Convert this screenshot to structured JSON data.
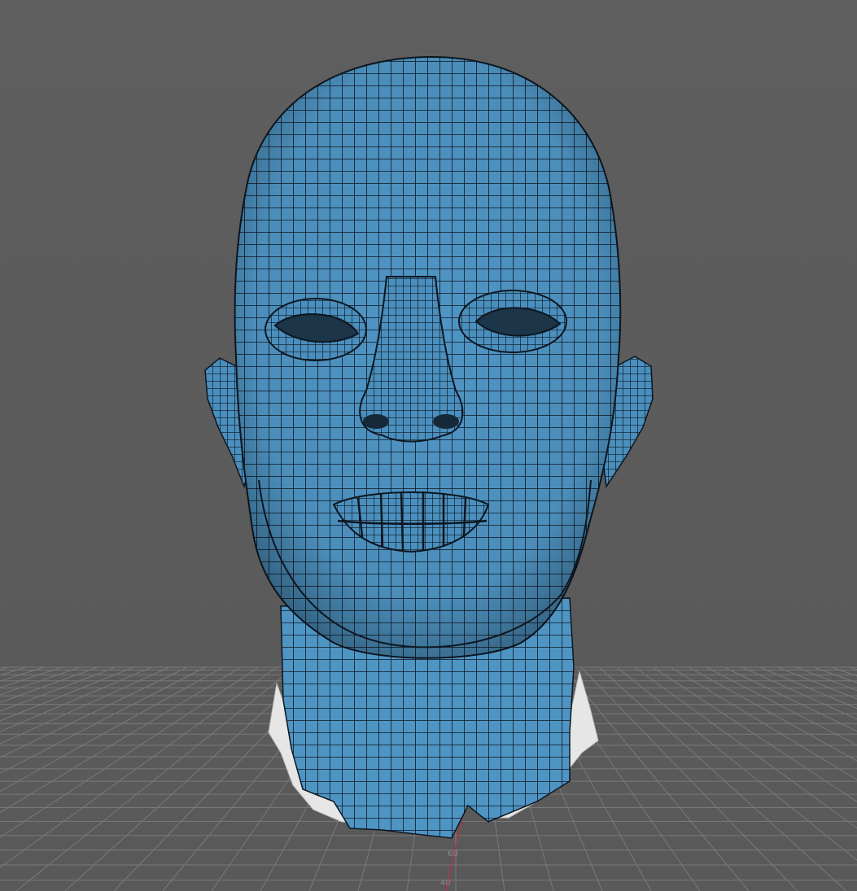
{
  "viewport": {
    "background_color": "#5d5d5d",
    "grid_color": "#7a7a7a",
    "axis_color": "#b0334a",
    "grid_labels": [
      "60",
      "40"
    ]
  },
  "mesh": {
    "object": "head-sculpt",
    "surface_color": "#4f95c4",
    "wire_color": "#0d1620",
    "subtool_color": "#e6e6e6"
  }
}
